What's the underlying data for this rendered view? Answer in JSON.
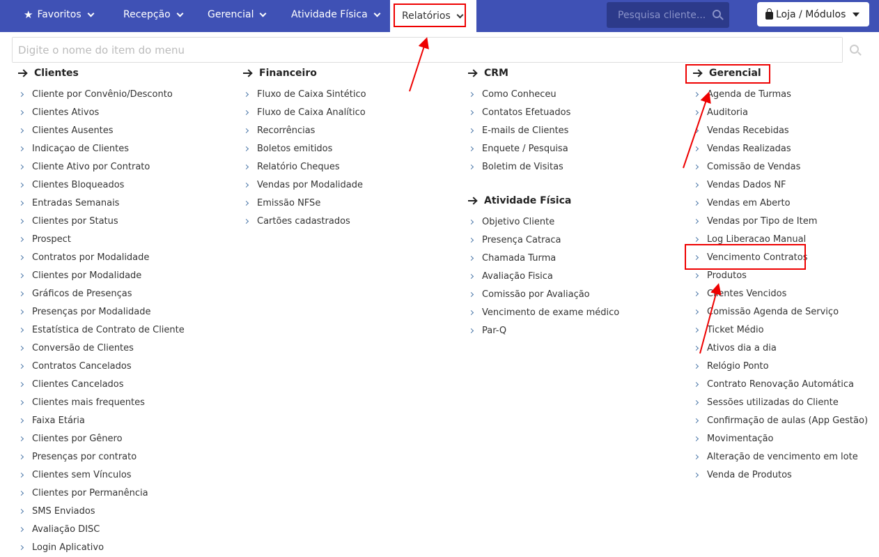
{
  "nav": {
    "favoritos": "Favoritos",
    "recepcao": "Recepção",
    "gerencial": "Gerencial",
    "atividade": "Atividade Física",
    "relatorios": "Relatórios",
    "search_placeholder": "Pesquisa cliente...",
    "loja": "Loja / Módulos"
  },
  "menu_search": {
    "placeholder": "Digite o nome do item do menu"
  },
  "columns": {
    "clientes": {
      "title": "Clientes",
      "items": [
        "Cliente por Convênio/Desconto",
        "Clientes Ativos",
        "Clientes Ausentes",
        "Indicaçao de Clientes",
        "Cliente Ativo por Contrato",
        "Clientes Bloqueados",
        "Entradas Semanais",
        "Clientes por Status",
        "Prospect",
        "Contratos por Modalidade",
        "Clientes por Modalidade",
        "Gráficos de Presenças",
        "Presenças por Modalidade",
        "Estatística de Contrato de Cliente",
        "Conversão de Clientes",
        "Contratos Cancelados",
        "Clientes Cancelados",
        "Clientes mais frequentes",
        "Faixa Etária",
        "Clientes por Gênero",
        "Presenças por contrato",
        "Clientes sem Vínculos",
        "Clientes por Permanência",
        "SMS Enviados",
        "Avaliação DISC",
        "Login Aplicativo"
      ]
    },
    "financeiro": {
      "title": "Financeiro",
      "items": [
        "Fluxo de Caixa Sintético",
        "Fluxo de Caixa Analítico",
        "Recorrências",
        "Boletos emitidos",
        "Relatório Cheques",
        "Vendas por Modalidade",
        "Emissão NFSe",
        "Cartões cadastrados"
      ]
    },
    "crm": {
      "title": "CRM",
      "items": [
        "Como Conheceu",
        "Contatos Efetuados",
        "E-mails de Clientes",
        "Enquete / Pesquisa",
        "Boletim de Visitas"
      ]
    },
    "atividade": {
      "title": "Atividade Física",
      "items": [
        "Objetivo Cliente",
        "Presença Catraca",
        "Chamada Turma",
        "Avaliação Fisica",
        "Comissão por Avaliação",
        "Vencimento de exame médico",
        "Par-Q"
      ]
    },
    "gerencial": {
      "title": "Gerencial",
      "items": [
        "Agenda de Turmas",
        "Auditoria",
        "Vendas Recebidas",
        "Vendas Realizadas",
        "Comissão de Vendas",
        "Vendas Dados NF",
        "Vendas em Aberto",
        "Vendas por Tipo de Item",
        "Log Liberacao Manual",
        "Vencimento Contratos",
        "Produtos",
        "Clientes Vencidos",
        "Comissão Agenda de Serviço",
        "Ticket Médio",
        "Ativos dia a dia",
        "Relógio Ponto",
        "Contrato Renovação Automática",
        "Sessões utilizadas do Cliente",
        "Confirmação de aulas (App Gestão)",
        "Movimentação",
        "Alteração de vencimento em lote",
        "Venda de Produtos"
      ]
    }
  },
  "colors": {
    "nav_bg": "#3f51b5",
    "search_bg": "#2c3a8a",
    "highlight": "#e00000",
    "bullet": "#4a76a8"
  }
}
